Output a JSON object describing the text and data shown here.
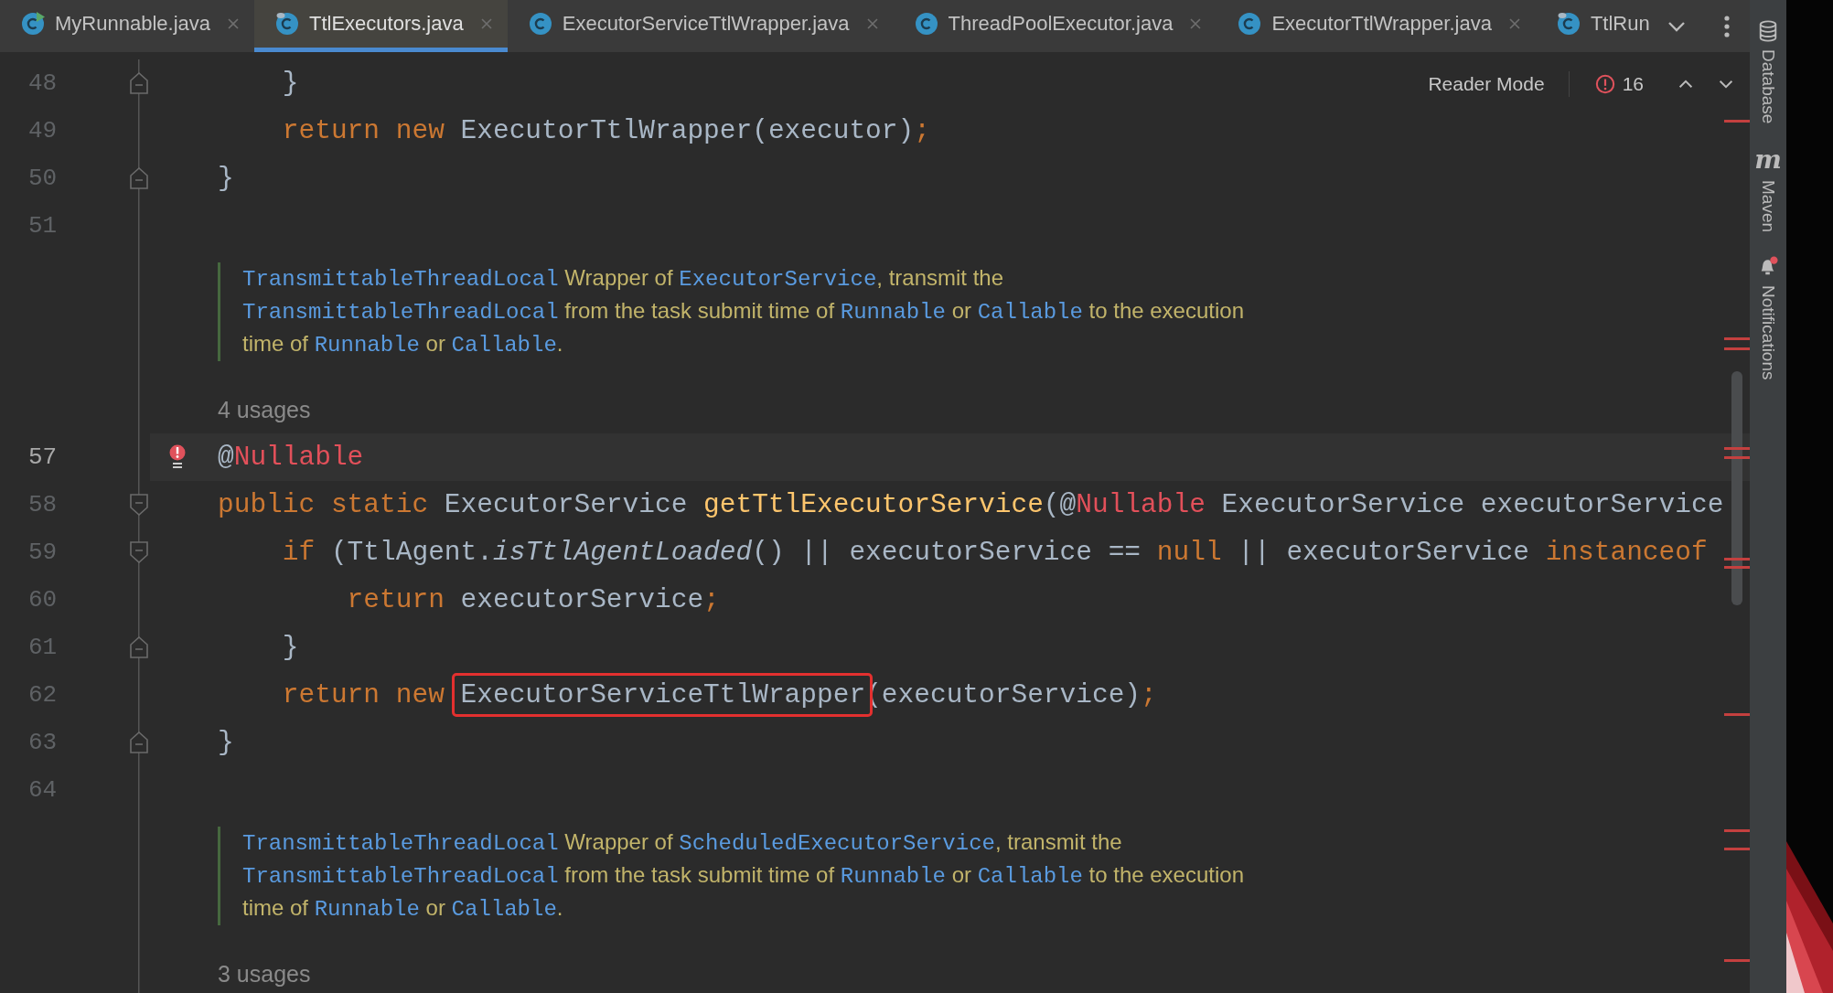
{
  "tabs": [
    {
      "label": "MyRunnable.java",
      "selected": false,
      "closable": true,
      "runnable": true
    },
    {
      "label": "TtlExecutors.java",
      "selected": true,
      "closable": true,
      "pinned": true
    },
    {
      "label": "ExecutorServiceTtlWrapper.java",
      "selected": false,
      "closable": true
    },
    {
      "label": "ThreadPoolExecutor.java",
      "selected": false,
      "closable": true
    },
    {
      "label": "ExecutorTtlWrapper.java",
      "selected": false,
      "closable": true
    },
    {
      "label": "TtlRun",
      "selected": false,
      "closable": false,
      "pinned": true
    }
  ],
  "reader_bar": {
    "label": "Reader Mode",
    "error_count": "16"
  },
  "editor": {
    "lines": [
      {
        "kind": "code",
        "number": "48",
        "current": false,
        "fold_end": true,
        "tokens": [
          {
            "t": "    }",
            "kind": "plain"
          }
        ]
      },
      {
        "kind": "code",
        "number": "49",
        "current": false,
        "tokens": [
          {
            "t": "    return new",
            "kind": "keyword"
          },
          {
            "t": " ExecutorTtlWrapper(executor)",
            "kind": "plain"
          },
          {
            "t": ";",
            "kind": "punct"
          }
        ]
      },
      {
        "kind": "code",
        "number": "50",
        "current": false,
        "fold_end": true,
        "tokens": [
          {
            "t": "}",
            "kind": "plain"
          }
        ]
      },
      {
        "kind": "code",
        "number": "51",
        "current": false
      },
      {
        "kind": "doc",
        "lines": [
          [
            {
              "t": "TransmittableThreadLocal",
              "kind": "ref"
            },
            {
              "t": " Wrapper of ",
              "kind": "text"
            },
            {
              "t": "ExecutorService",
              "kind": "ref"
            },
            {
              "t": ", transmit the",
              "kind": "text"
            }
          ],
          [
            {
              "t": "TransmittableThreadLocal",
              "kind": "ref"
            },
            {
              "t": " from the task submit time of ",
              "kind": "text"
            },
            {
              "t": "Runnable",
              "kind": "ref"
            },
            {
              "t": " or ",
              "kind": "text"
            },
            {
              "t": "Callable",
              "kind": "ref"
            },
            {
              "t": " to the execution",
              "kind": "text"
            }
          ],
          [
            {
              "t": "time of ",
              "kind": "text"
            },
            {
              "t": "Runnable",
              "kind": "ref"
            },
            {
              "t": " or ",
              "kind": "text"
            },
            {
              "t": "Callable",
              "kind": "ref"
            },
            {
              "t": ".",
              "kind": "text"
            }
          ]
        ]
      },
      {
        "kind": "usages",
        "text": "4 usages"
      },
      {
        "kind": "code",
        "number": "57",
        "current": true,
        "error_bulb": true,
        "tokens": [
          {
            "t": "@",
            "kind": "plain"
          },
          {
            "t": "Nullable",
            "kind": "error"
          }
        ]
      },
      {
        "kind": "code",
        "number": "58",
        "current": false,
        "fold_start": true,
        "tokens": [
          {
            "t": "public static",
            "kind": "keyword"
          },
          {
            "t": " ExecutorService ",
            "kind": "plain"
          },
          {
            "t": "getTtlExecutorService",
            "kind": "method"
          },
          {
            "t": "(@",
            "kind": "plain"
          },
          {
            "t": "Nullable",
            "kind": "error"
          },
          {
            "t": " ExecutorService executorService",
            "kind": "plain"
          }
        ]
      },
      {
        "kind": "code",
        "number": "59",
        "current": false,
        "fold_start": true,
        "tokens": [
          {
            "t": "    if",
            "kind": "keyword"
          },
          {
            "t": " (TtlAgent.",
            "kind": "plain"
          },
          {
            "t": "isTtlAgentLoaded",
            "kind": "italic"
          },
          {
            "t": "() || executorService == ",
            "kind": "plain"
          },
          {
            "t": "null",
            "kind": "keyword"
          },
          {
            "t": " || executorService ",
            "kind": "plain"
          },
          {
            "t": "instanceof",
            "kind": "keyword"
          }
        ]
      },
      {
        "kind": "code",
        "number": "60",
        "current": false,
        "tokens": [
          {
            "t": "        return",
            "kind": "keyword"
          },
          {
            "t": " executorService",
            "kind": "plain"
          },
          {
            "t": ";",
            "kind": "punct"
          }
        ]
      },
      {
        "kind": "code",
        "number": "61",
        "current": false,
        "fold_end": true,
        "tokens": [
          {
            "t": "    }",
            "kind": "plain"
          }
        ]
      },
      {
        "kind": "code",
        "number": "62",
        "current": false,
        "tokens": [
          {
            "t": "    return new ",
            "kind": "keyword"
          },
          {
            "t": "ExecutorServiceTtlWrapper",
            "kind": "plain",
            "highlighted": true
          },
          {
            "t": "(executorService)",
            "kind": "plain"
          },
          {
            "t": ";",
            "kind": "punct"
          }
        ]
      },
      {
        "kind": "code",
        "number": "63",
        "current": false,
        "fold_end": true,
        "tokens": [
          {
            "t": "}",
            "kind": "plain"
          }
        ]
      },
      {
        "kind": "code",
        "number": "64",
        "current": false
      },
      {
        "kind": "doc",
        "lines": [
          [
            {
              "t": "TransmittableThreadLocal",
              "kind": "ref"
            },
            {
              "t": " Wrapper of ",
              "kind": "text"
            },
            {
              "t": "ScheduledExecutorService",
              "kind": "ref"
            },
            {
              "t": ", transmit the",
              "kind": "text"
            }
          ],
          [
            {
              "t": "TransmittableThreadLocal",
              "kind": "ref"
            },
            {
              "t": " from the task submit time of ",
              "kind": "text"
            },
            {
              "t": "Runnable",
              "kind": "ref"
            },
            {
              "t": " or ",
              "kind": "text"
            },
            {
              "t": "Callable",
              "kind": "ref"
            },
            {
              "t": " to the execution",
              "kind": "text"
            }
          ],
          [
            {
              "t": "time of ",
              "kind": "text"
            },
            {
              "t": "Runnable",
              "kind": "ref"
            },
            {
              "t": " or ",
              "kind": "text"
            },
            {
              "t": "Callable",
              "kind": "ref"
            },
            {
              "t": ".",
              "kind": "text"
            }
          ]
        ]
      },
      {
        "kind": "usages",
        "text": "3 usages"
      }
    ]
  },
  "tool_windows": [
    {
      "label": "Database"
    },
    {
      "label": "Maven",
      "glyph": "m"
    },
    {
      "label": "Notifications",
      "unread": true
    }
  ]
}
